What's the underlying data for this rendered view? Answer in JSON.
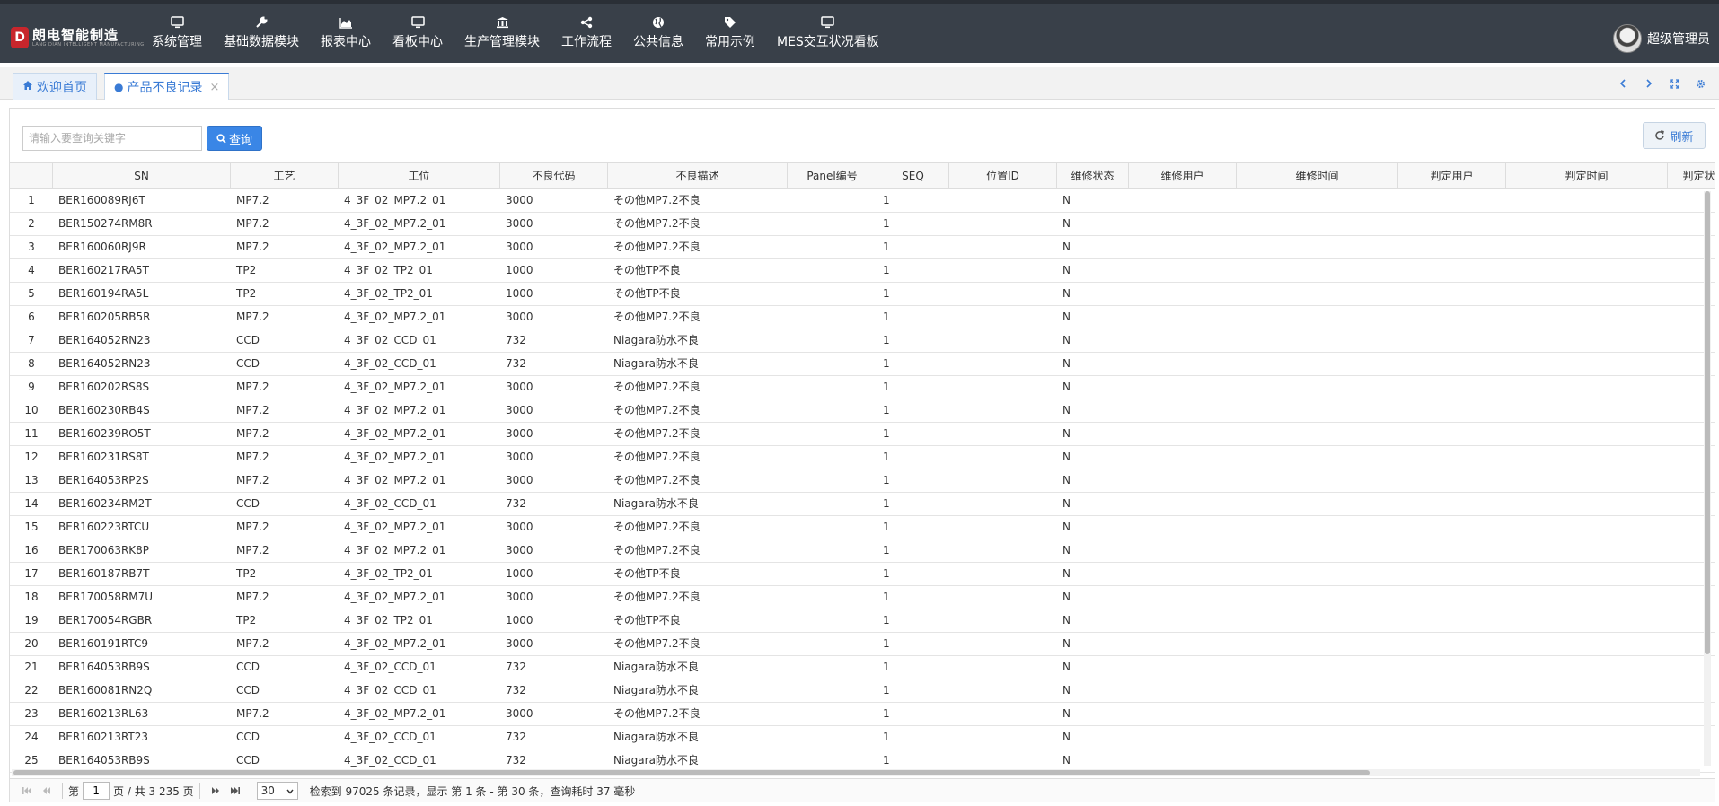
{
  "app": {
    "logo_main": "朗电智能制造",
    "logo_sub": "LANG DIAN INTELLIGENT MANUFACTURING",
    "user_name": "超级管理员"
  },
  "nav": [
    {
      "label": "系统管理",
      "icon": "monitor-icon"
    },
    {
      "label": "基础数据模块",
      "icon": "wrench-icon"
    },
    {
      "label": "报表中心",
      "icon": "area-chart-icon"
    },
    {
      "label": "看板中心",
      "icon": "monitor-icon"
    },
    {
      "label": "生产管理模块",
      "icon": "bank-icon"
    },
    {
      "label": "工作流程",
      "icon": "share-icon"
    },
    {
      "label": "公共信息",
      "icon": "globe-icon"
    },
    {
      "label": "常用示例",
      "icon": "tags-icon"
    },
    {
      "label": "MES交互状况看板",
      "icon": "monitor-icon"
    }
  ],
  "tabs": [
    {
      "label": "欢迎首页"
    },
    {
      "label": "产品不良记录"
    }
  ],
  "toolbar": {
    "search_placeholder": "请输入要查询关键字",
    "search_label": "查询",
    "refresh_label": "刷新"
  },
  "columns": [
    "SN",
    "工艺",
    "工位",
    "不良代码",
    "不良描述",
    "Panel编号",
    "SEQ",
    "位置ID",
    "维修状态",
    "维修用户",
    "维修时间",
    "判定用户",
    "判定时间",
    "判定状"
  ],
  "rows": [
    {
      "no": "1",
      "sn": "BER160089RJ6T",
      "proc": "MP7.2",
      "station": "4_3F_02_MP7.2_01",
      "code": "3000",
      "desc": "その他MP7.2不良",
      "seq": "1",
      "status": "N"
    },
    {
      "no": "2",
      "sn": "BER150274RM8R",
      "proc": "MP7.2",
      "station": "4_3F_02_MP7.2_01",
      "code": "3000",
      "desc": "その他MP7.2不良",
      "seq": "1",
      "status": "N"
    },
    {
      "no": "3",
      "sn": "BER160060RJ9R",
      "proc": "MP7.2",
      "station": "4_3F_02_MP7.2_01",
      "code": "3000",
      "desc": "その他MP7.2不良",
      "seq": "1",
      "status": "N"
    },
    {
      "no": "4",
      "sn": "BER160217RA5T",
      "proc": "TP2",
      "station": "4_3F_02_TP2_01",
      "code": "1000",
      "desc": "その他TP不良",
      "seq": "1",
      "status": "N"
    },
    {
      "no": "5",
      "sn": "BER160194RA5L",
      "proc": "TP2",
      "station": "4_3F_02_TP2_01",
      "code": "1000",
      "desc": "その他TP不良",
      "seq": "1",
      "status": "N"
    },
    {
      "no": "6",
      "sn": "BER160205RB5R",
      "proc": "MP7.2",
      "station": "4_3F_02_MP7.2_01",
      "code": "3000",
      "desc": "その他MP7.2不良",
      "seq": "1",
      "status": "N"
    },
    {
      "no": "7",
      "sn": "BER164052RN23",
      "proc": "CCD",
      "station": "4_3F_02_CCD_01",
      "code": "732",
      "desc": "Niagara防水不良",
      "seq": "1",
      "status": "N"
    },
    {
      "no": "8",
      "sn": "BER164052RN23",
      "proc": "CCD",
      "station": "4_3F_02_CCD_01",
      "code": "732",
      "desc": "Niagara防水不良",
      "seq": "1",
      "status": "N"
    },
    {
      "no": "9",
      "sn": "BER160202RS8S",
      "proc": "MP7.2",
      "station": "4_3F_02_MP7.2_01",
      "code": "3000",
      "desc": "その他MP7.2不良",
      "seq": "1",
      "status": "N"
    },
    {
      "no": "10",
      "sn": "BER160230RB4S",
      "proc": "MP7.2",
      "station": "4_3F_02_MP7.2_01",
      "code": "3000",
      "desc": "その他MP7.2不良",
      "seq": "1",
      "status": "N"
    },
    {
      "no": "11",
      "sn": "BER160239RO5T",
      "proc": "MP7.2",
      "station": "4_3F_02_MP7.2_01",
      "code": "3000",
      "desc": "その他MP7.2不良",
      "seq": "1",
      "status": "N"
    },
    {
      "no": "12",
      "sn": "BER160231RS8T",
      "proc": "MP7.2",
      "station": "4_3F_02_MP7.2_01",
      "code": "3000",
      "desc": "その他MP7.2不良",
      "seq": "1",
      "status": "N"
    },
    {
      "no": "13",
      "sn": "BER164053RP2S",
      "proc": "MP7.2",
      "station": "4_3F_02_MP7.2_01",
      "code": "3000",
      "desc": "その他MP7.2不良",
      "seq": "1",
      "status": "N"
    },
    {
      "no": "14",
      "sn": "BER160234RM2T",
      "proc": "CCD",
      "station": "4_3F_02_CCD_01",
      "code": "732",
      "desc": "Niagara防水不良",
      "seq": "1",
      "status": "N"
    },
    {
      "no": "15",
      "sn": "BER160223RTCU",
      "proc": "MP7.2",
      "station": "4_3F_02_MP7.2_01",
      "code": "3000",
      "desc": "その他MP7.2不良",
      "seq": "1",
      "status": "N"
    },
    {
      "no": "16",
      "sn": "BER170063RK8P",
      "proc": "MP7.2",
      "station": "4_3F_02_MP7.2_01",
      "code": "3000",
      "desc": "その他MP7.2不良",
      "seq": "1",
      "status": "N"
    },
    {
      "no": "17",
      "sn": "BER160187RB7T",
      "proc": "TP2",
      "station": "4_3F_02_TP2_01",
      "code": "1000",
      "desc": "その他TP不良",
      "seq": "1",
      "status": "N"
    },
    {
      "no": "18",
      "sn": "BER170058RM7U",
      "proc": "MP7.2",
      "station": "4_3F_02_MP7.2_01",
      "code": "3000",
      "desc": "その他MP7.2不良",
      "seq": "1",
      "status": "N"
    },
    {
      "no": "19",
      "sn": "BER170054RGBR",
      "proc": "TP2",
      "station": "4_3F_02_TP2_01",
      "code": "1000",
      "desc": "その他TP不良",
      "seq": "1",
      "status": "N"
    },
    {
      "no": "20",
      "sn": "BER160191RTC9",
      "proc": "MP7.2",
      "station": "4_3F_02_MP7.2_01",
      "code": "3000",
      "desc": "その他MP7.2不良",
      "seq": "1",
      "status": "N"
    },
    {
      "no": "21",
      "sn": "BER164053RB9S",
      "proc": "CCD",
      "station": "4_3F_02_CCD_01",
      "code": "732",
      "desc": "Niagara防水不良",
      "seq": "1",
      "status": "N"
    },
    {
      "no": "22",
      "sn": "BER160081RN2Q",
      "proc": "CCD",
      "station": "4_3F_02_CCD_01",
      "code": "732",
      "desc": "Niagara防水不良",
      "seq": "1",
      "status": "N"
    },
    {
      "no": "23",
      "sn": "BER160213RL63",
      "proc": "MP7.2",
      "station": "4_3F_02_MP7.2_01",
      "code": "3000",
      "desc": "その他MP7.2不良",
      "seq": "1",
      "status": "N"
    },
    {
      "no": "24",
      "sn": "BER160213RT23",
      "proc": "CCD",
      "station": "4_3F_02_CCD_01",
      "code": "732",
      "desc": "Niagara防水不良",
      "seq": "1",
      "status": "N"
    },
    {
      "no": "25",
      "sn": "BER164053RB9S",
      "proc": "CCD",
      "station": "4_3F_02_CCD_01",
      "code": "732",
      "desc": "Niagara防水不良",
      "seq": "1",
      "status": "N"
    }
  ],
  "pager": {
    "page_prefix": "第",
    "page_value": "1",
    "page_suffix": "页 / 共 3 235 页",
    "page_size": "30",
    "summary": "检索到 97025 条记录，显示 第 1 条 - 第 30 条，查询耗时 37 毫秒"
  },
  "colors": {
    "topbar": "#394049",
    "accent": "#3a86e6",
    "brand": "#c8262c"
  }
}
